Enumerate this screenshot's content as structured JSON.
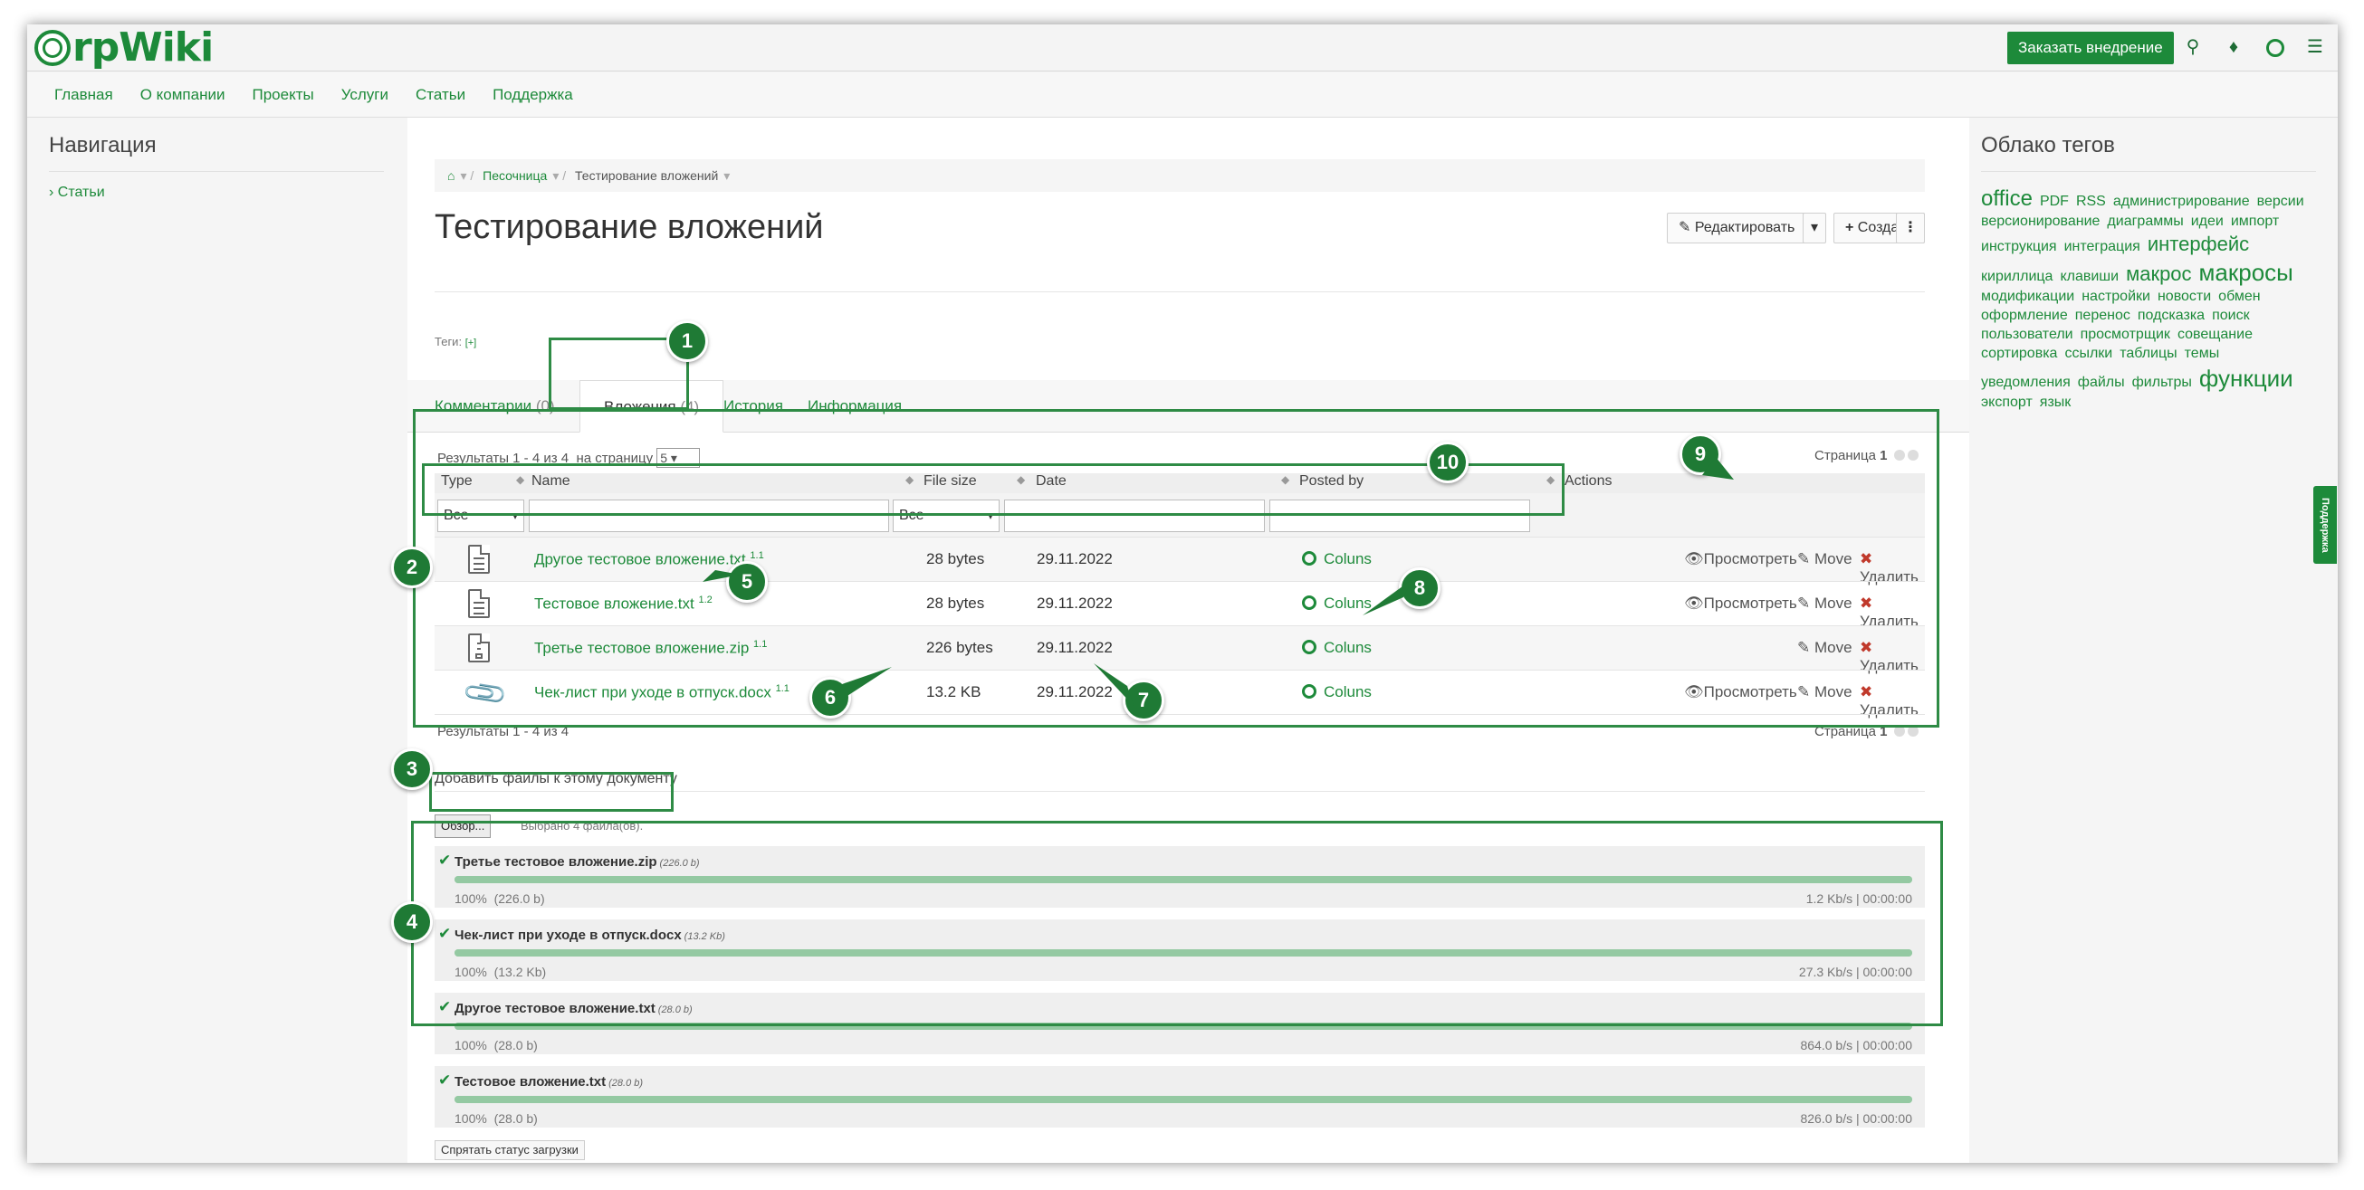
{
  "header": {
    "logo_text": "rpWiki",
    "cta_label": "Заказать внедрение",
    "icons": [
      "search-icon",
      "bell-icon",
      "globe-icon",
      "hamburger-icon"
    ]
  },
  "nav": {
    "items": [
      "Главная",
      "О компании",
      "Проекты",
      "Услуги",
      "Статьи",
      "Поддержка"
    ]
  },
  "left_sidebar": {
    "title": "Навигация",
    "link": "Статьи"
  },
  "breadcrumb": {
    "items": [
      "Песочница",
      "Тестирование вложений"
    ]
  },
  "page": {
    "title": "Тестирование вложений",
    "edit_label": "Редактировать",
    "create_label": "Создать",
    "tags_label": "Теги:",
    "tags_add": "[+]"
  },
  "tabs": [
    {
      "label": "Комментарии",
      "count": "(0)"
    },
    {
      "label": "Вложения",
      "count": "(4)"
    },
    {
      "label": "История",
      "count": ""
    },
    {
      "label": "Информация",
      "count": ""
    }
  ],
  "attachments": {
    "results_text": "Результаты 1 - 4 из 4",
    "per_page_label": "на страницу",
    "per_page_value": "5",
    "page_label": "Страница",
    "page_number": "1",
    "columns": [
      "Type",
      "Name",
      "File size",
      "Date",
      "Posted by",
      "Actions"
    ],
    "filter_type": "Все",
    "filter_size": "Все",
    "rows": [
      {
        "icon": "text-file-icon",
        "name": "Другое тестовое вложение.txt",
        "version": "1.1",
        "size": "28 bytes",
        "date": "29.11.2022",
        "author": "Coluns",
        "view": "Просмотреть",
        "move": "Move",
        "delete": "Удалить"
      },
      {
        "icon": "text-file-icon",
        "name": "Тестовое вложение.txt",
        "version": "1.2",
        "size": "28 bytes",
        "date": "29.11.2022",
        "author": "Coluns",
        "view": "Просмотреть",
        "move": "Move",
        "delete": "Удалить"
      },
      {
        "icon": "zip-file-icon",
        "name": "Третье тестовое вложение.zip",
        "version": "1.1",
        "size": "226 bytes",
        "date": "29.11.2022",
        "author": "Coluns",
        "view": "",
        "move": "Move",
        "delete": "Удалить"
      },
      {
        "icon": "paperclip-icon",
        "name": "Чек-лист при уходе в отпуск.docx",
        "version": "1.1",
        "size": "13.2 KB",
        "date": "29.11.2022",
        "author": "Coluns",
        "view": "Просмотреть",
        "move": "Move",
        "delete": "Удалить"
      }
    ]
  },
  "upload": {
    "title": "Добавить файлы к этому документу",
    "browse_label": "Обзор...",
    "chosen_text": "Выбрано 4 файла(ов).",
    "hide_label": "Спрятать статус загрузки",
    "items": [
      {
        "name": "Третье тестовое вложение.zip",
        "size": "(226.0 b)",
        "percent": "100%",
        "done": "(226.0 b)",
        "speed": "1.2 Kb/s | 00:00:00",
        "progress": 1.0
      },
      {
        "name": "Чек-лист при уходе в отпуск.docx",
        "size": "(13.2 Kb)",
        "percent": "100%",
        "done": "(13.2 Kb)",
        "speed": "27.3 Kb/s | 00:00:00",
        "progress": 1.0
      },
      {
        "name": "Другое тестовое вложение.txt",
        "size": "(28.0 b)",
        "percent": "100%",
        "done": "(28.0 b)",
        "speed": "864.0 b/s | 00:00:00",
        "progress": 1.0
      },
      {
        "name": "Тестовое вложение.txt",
        "size": "(28.0 b)",
        "percent": "100%",
        "done": "(28.0 b)",
        "speed": "826.0 b/s | 00:00:00",
        "progress": 1.0
      }
    ]
  },
  "right_sidebar": {
    "title": "Облако тегов",
    "tags": [
      "office",
      "PDF",
      "RSS",
      "администрирование",
      "версии",
      "версионирование",
      "диаграммы",
      "идеи",
      "импорт",
      "инструкция",
      "интеграция",
      "интерфейс",
      "кириллица",
      "клавиши",
      "макрос",
      "макросы",
      "модификации",
      "настройки",
      "новости",
      "обмен",
      "оформление",
      "перенос",
      "подсказка",
      "поиск",
      "пользователи",
      "просмотрщик",
      "совещание",
      "сортировка",
      "ссылки",
      "таблицы",
      "темы",
      "уведомления",
      "файлы",
      "фильтры",
      "функции",
      "экспорт",
      "язык"
    ]
  },
  "support_tab": "Поддержка",
  "annotations": [
    "1",
    "2",
    "3",
    "4",
    "5",
    "6",
    "7",
    "8",
    "9",
    "10"
  ],
  "colors": {
    "accent": "#1d8a3a",
    "annotation": "#1f7a35",
    "delete": "#c0392b"
  }
}
